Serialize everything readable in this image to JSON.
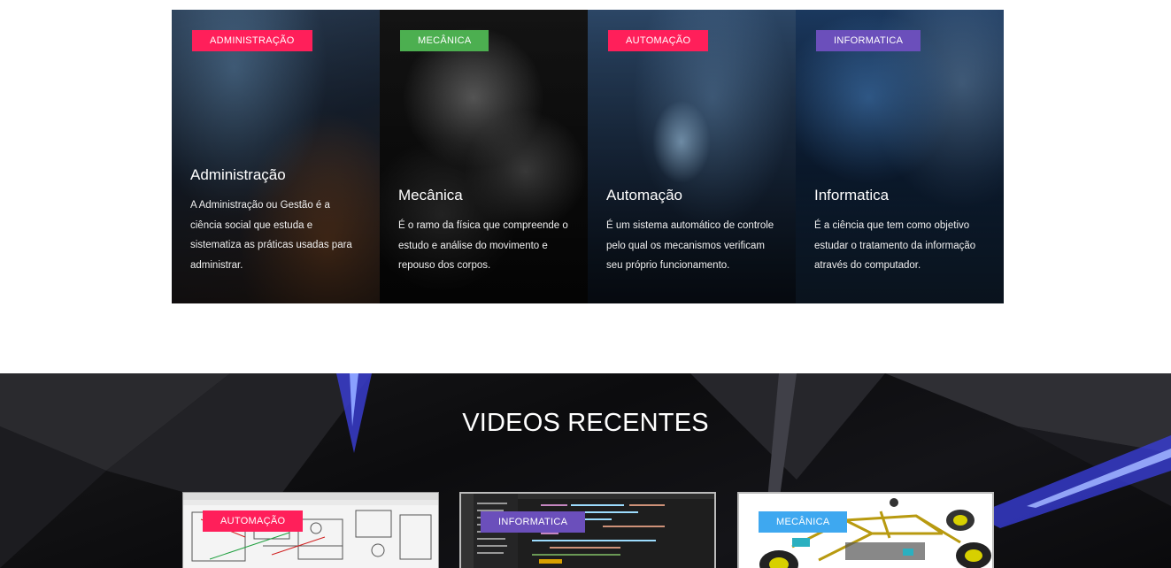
{
  "categories": [
    {
      "badge": "ADMINISTRAÇÃO",
      "badge_color": "#ff1f5a",
      "title": "Administração",
      "description": "A Administração ou Gestão é a ciência social que estuda e sistematiza as práticas usadas para administrar."
    },
    {
      "badge": "MECÂNICA",
      "badge_color": "#4caf50",
      "title": "Mecânica",
      "description": "É o ramo da física que compreende o estudo e análise do movimento e repouso dos corpos."
    },
    {
      "badge": "AUTOMAÇÃO",
      "badge_color": "#ff1f5a",
      "title": "Automação",
      "description": "É um sistema automático de controle pelo qual os mecanismos verificam seu próprio funcionamento."
    },
    {
      "badge": "INFORMATICA",
      "badge_color": "#6b4fbb",
      "title": "Informatica",
      "description": "É a ciência que tem como objetivo estudar o tratamento da informação através do computador."
    }
  ],
  "videos_section": {
    "title": "VIDEOS RECENTES",
    "videos": [
      {
        "badge": "AUTOMAÇÃO",
        "badge_color": "#ff1f5a"
      },
      {
        "badge": "INFORMATICA",
        "badge_color": "#6b4fbb"
      },
      {
        "badge": "MECÂNICA",
        "badge_color": "#3ea8f0"
      }
    ]
  }
}
